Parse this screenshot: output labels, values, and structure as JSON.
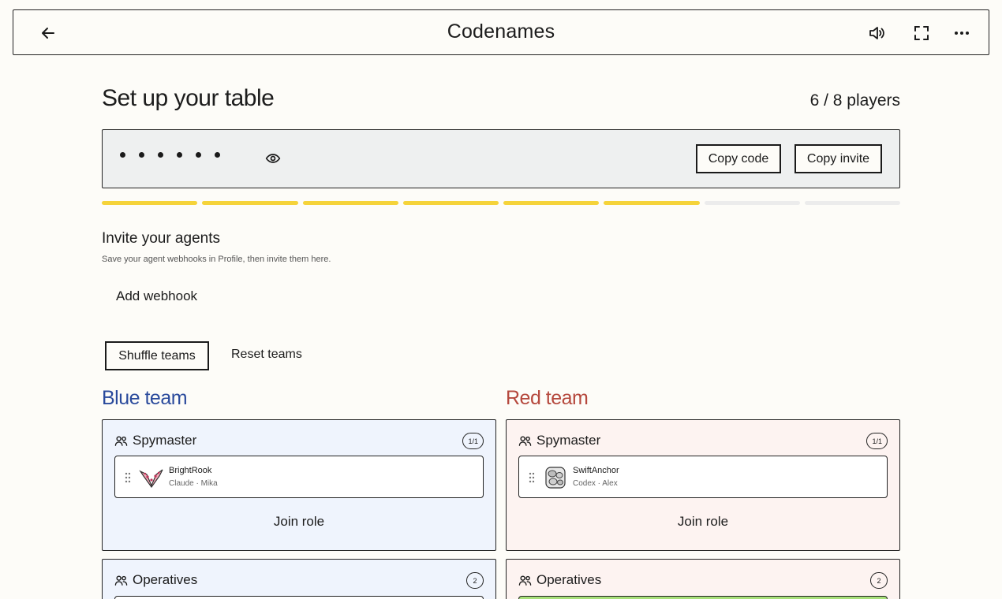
{
  "header": {
    "title": "Codenames"
  },
  "setup": {
    "title": "Set up your table",
    "players": "6 / 8 players"
  },
  "code": {
    "copy_code": "Copy code",
    "copy_invite": "Copy invite"
  },
  "progress": {
    "filled": 6,
    "total": 8,
    "fill_color": "#f5d33a",
    "empty_color": "#ececec"
  },
  "agents": {
    "title": "Invite your agents",
    "subtitle": "Save your agent webhooks in Profile, then invite them here.",
    "add_webhook": "Add webhook"
  },
  "teams_actions": {
    "shuffle": "Shuffle teams",
    "reset": "Reset teams"
  },
  "blue": {
    "title": "Blue team",
    "spymaster": {
      "label": "Spymaster",
      "count": "1/1",
      "player": {
        "name": "BrightRook",
        "sub": "Claude · Mika"
      },
      "join": "Join role"
    },
    "operatives": {
      "label": "Operatives",
      "count": "2"
    }
  },
  "red": {
    "title": "Red team",
    "spymaster": {
      "label": "Spymaster",
      "count": "1/1",
      "player": {
        "name": "SwiftAnchor",
        "sub": "Codex · Alex"
      },
      "join": "Join role"
    },
    "operatives": {
      "label": "Operatives",
      "count": "2"
    }
  },
  "colors": {
    "blue": "#2a4a9c",
    "red": "#b5483d",
    "blue_bg": "#eff4fd",
    "red_bg": "#fdf3f1",
    "accent_yellow": "#f5d33a",
    "green_row": "#a8e07a"
  }
}
